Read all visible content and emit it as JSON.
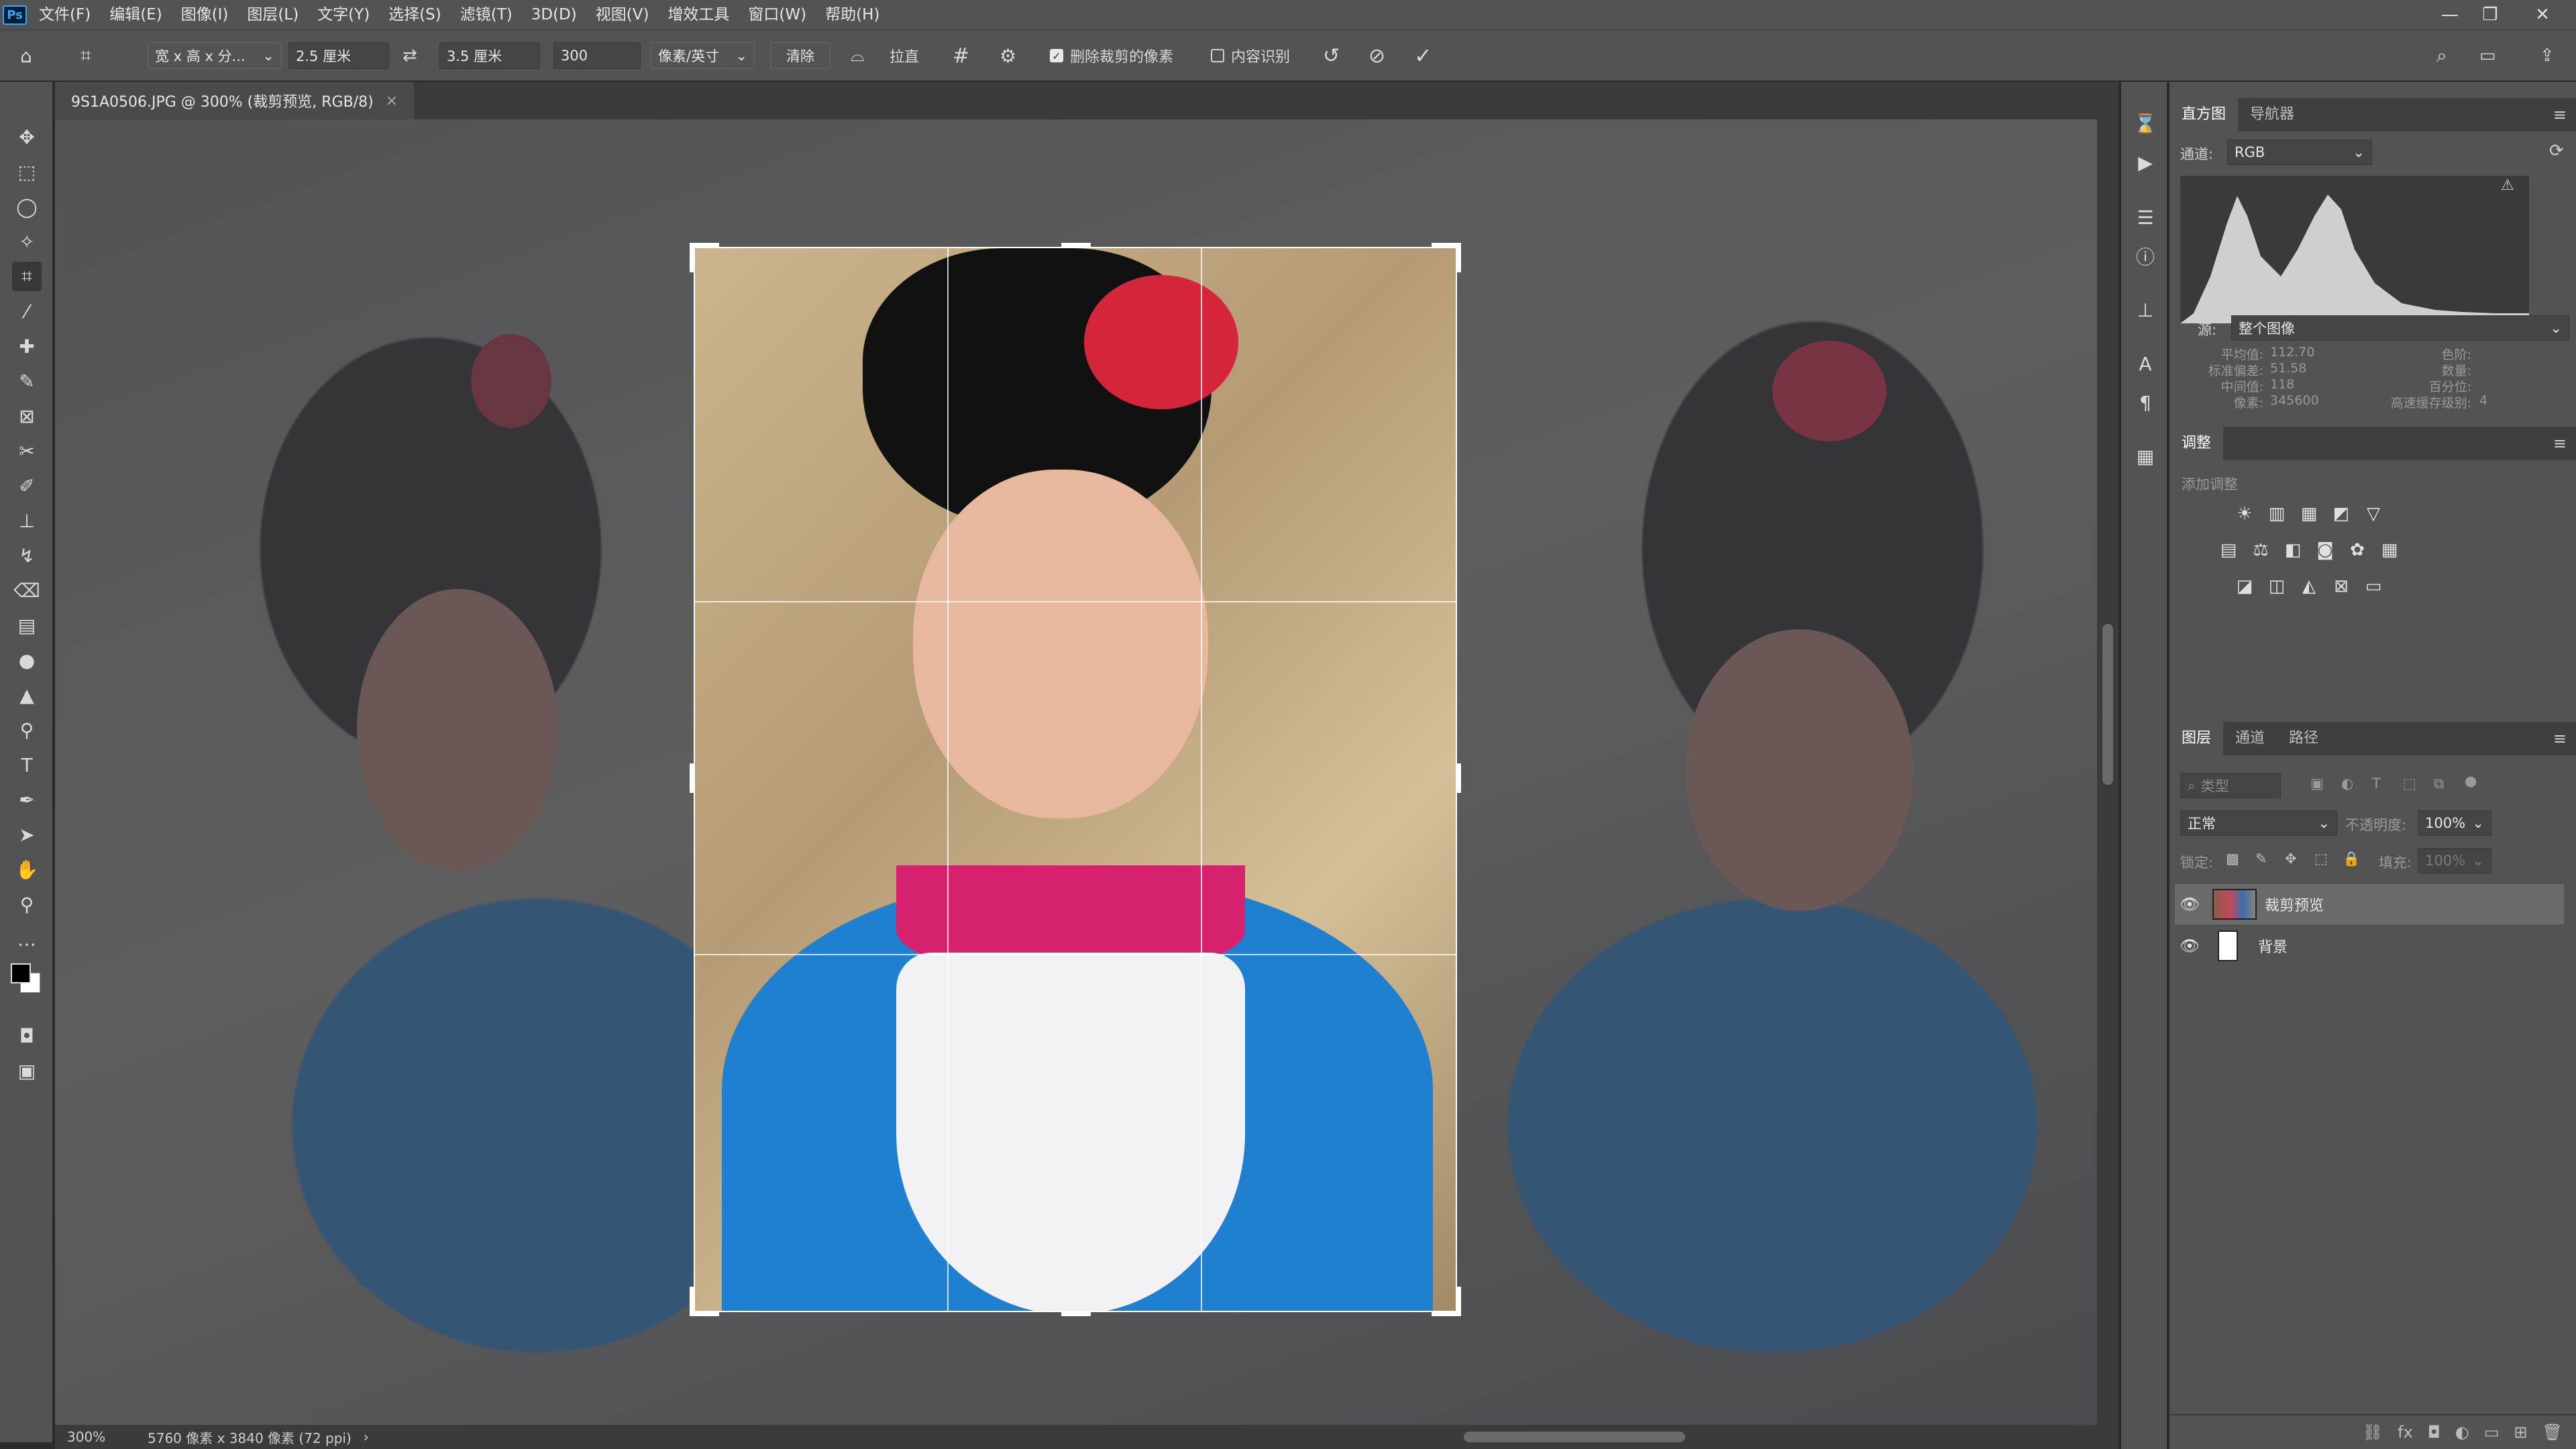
{
  "app": {
    "logo": "Ps"
  },
  "menu": [
    "文件(F)",
    "编辑(E)",
    "图像(I)",
    "图层(L)",
    "文字(Y)",
    "选择(S)",
    "滤镜(T)",
    "3D(D)",
    "视图(V)",
    "增效工具",
    "窗口(W)",
    "帮助(H)"
  ],
  "window_controls": {
    "minimize": "—",
    "restore": "❐",
    "close": "✕"
  },
  "options": {
    "ratio_preset": "宽 x 高 x 分...",
    "width": "2.5 厘米",
    "swap_icon": "⇄",
    "height": "3.5 厘米",
    "resolution": "300",
    "resolution_unit": "像素/英寸",
    "clear": "清除",
    "straighten": "拉直",
    "delete_cropped": "删除裁剪的像素",
    "delete_cropped_checked": true,
    "content_aware": "内容识别",
    "content_aware_checked": false
  },
  "document": {
    "tab_title": "9S1A0506.JPG @ 300% (裁剪预览, RGB/8)",
    "close": "×"
  },
  "status": {
    "zoom": "300%",
    "info": "5760 像素 x 3840 像素 (72 ppi)",
    "arrow": "›"
  },
  "histogram_panel": {
    "tabs": [
      "直方图",
      "导航器"
    ],
    "channel_label": "通道:",
    "channel": "RGB",
    "source_label": "源:",
    "source": "整个图像",
    "stats_left": [
      {
        "label": "平均值:",
        "value": "112.70"
      },
      {
        "label": "标准偏差:",
        "value": "51.58"
      },
      {
        "label": "中间值:",
        "value": "118"
      },
      {
        "label": "像素:",
        "value": "345600"
      }
    ],
    "stats_right": [
      {
        "label": "色阶:",
        "value": ""
      },
      {
        "label": "数量:",
        "value": ""
      },
      {
        "label": "百分位:",
        "value": ""
      },
      {
        "label": "高速缓存级别:",
        "value": "4"
      }
    ]
  },
  "adjustments_panel": {
    "title": "调整",
    "add_label": "添加调整"
  },
  "layers_panel": {
    "tabs": [
      "图层",
      "通道",
      "路径"
    ],
    "filter_placeholder": "类型",
    "blend_mode": "正常",
    "opacity_label": "不透明度:",
    "opacity": "100%",
    "lock_label": "锁定:",
    "fill_label": "填充:",
    "fill": "100%",
    "layers": [
      {
        "name": "裁剪预览",
        "visible": true,
        "selected": true
      },
      {
        "name": "背景",
        "visible": true,
        "selected": false
      }
    ]
  }
}
